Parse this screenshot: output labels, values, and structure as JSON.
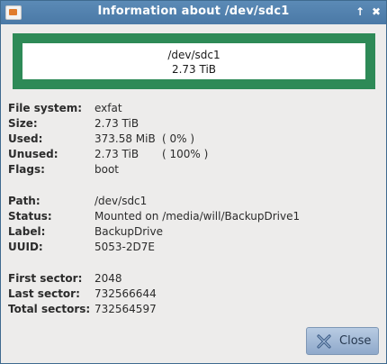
{
  "window": {
    "title": "Information about /dev/sdc1",
    "maximize_glyph": "↑",
    "close_glyph": "✖",
    "app_icon": "gparted-icon"
  },
  "partition_graphic": {
    "name": "/dev/sdc1",
    "size": "2.73 TiB",
    "color": "#2e8a57"
  },
  "details": {
    "file_system_label": "File system:",
    "file_system": "exfat",
    "size_label": "Size:",
    "size": "2.73 TiB",
    "used_label": "Used:",
    "used": "373.58 MiB",
    "used_pct": "( 0% )",
    "unused_label": "Unused:",
    "unused": "2.73 TiB",
    "unused_pct": "( 100% )",
    "flags_label": "Flags:",
    "flags": "boot",
    "path_label": "Path:",
    "path": "/dev/sdc1",
    "status_label": "Status:",
    "status": "Mounted on /media/will/BackupDrive1",
    "label_label": "Label:",
    "label": "BackupDrive",
    "uuid_label": "UUID:",
    "uuid": "5053-2D7E",
    "first_sector_label": "First sector:",
    "first_sector": "2048",
    "last_sector_label": "Last sector:",
    "last_sector": "732566644",
    "total_sectors_label": "Total sectors:",
    "total_sectors": "732564597"
  },
  "buttons": {
    "close_label": "Close",
    "close_icon": "close-x-icon"
  }
}
